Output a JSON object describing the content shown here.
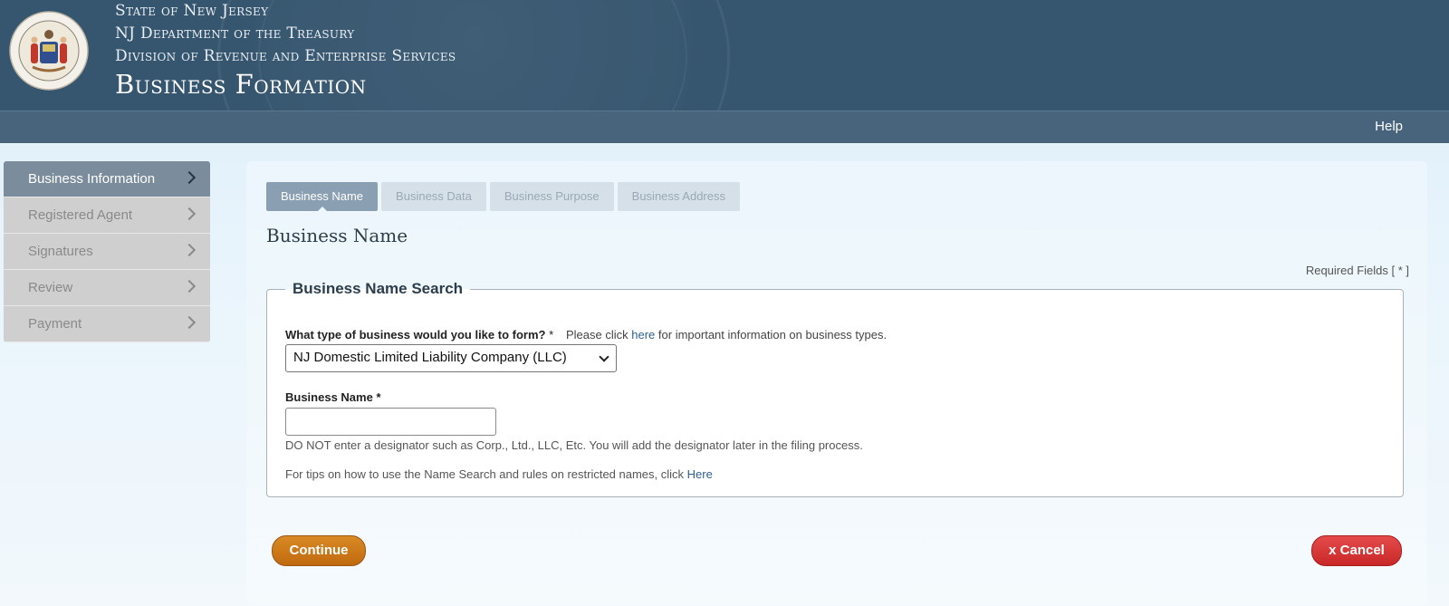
{
  "header": {
    "line1": "State of New Jersey",
    "line2": "NJ Department of the Treasury",
    "line3": "Division of Revenue and Enterprise Services",
    "title": "Business Formation",
    "bg_color": "#36566f"
  },
  "navbar": {
    "help_label": "Help"
  },
  "sidebar": {
    "items": [
      {
        "label": "Business Information",
        "active": true
      },
      {
        "label": "Registered Agent",
        "active": false
      },
      {
        "label": "Signatures",
        "active": false
      },
      {
        "label": "Review",
        "active": false
      },
      {
        "label": "Payment",
        "active": false
      }
    ]
  },
  "tabs": [
    {
      "label": "Business Name",
      "active": true
    },
    {
      "label": "Business Data",
      "active": false
    },
    {
      "label": "Business Purpose",
      "active": false
    },
    {
      "label": "Business Address",
      "active": false
    }
  ],
  "main": {
    "section_title": "Business Name",
    "required_note": "Required Fields [ * ]",
    "fieldset_legend": "Business Name Search",
    "business_type_label": "What type of business would you like to form?",
    "required_star": "*",
    "info_prefix": "Please click",
    "info_link": "here",
    "info_suffix": "for important information on business types.",
    "business_type_value": "NJ Domestic Limited Liability Company (LLC)",
    "business_name_label": "Business Name",
    "business_name_value": "",
    "hint_designator": "DO NOT enter a designator such as Corp., Ltd., LLC, Etc. You will add the designator later in the filing process.",
    "hint_tips_prefix": "For tips on how to use the Name Search and rules on restricted names, click",
    "hint_tips_link": "Here"
  },
  "actions": {
    "continue_label": "Continue",
    "cancel_label": "x Cancel",
    "continue_color": "#c9731a",
    "cancel_color": "#d43434"
  }
}
